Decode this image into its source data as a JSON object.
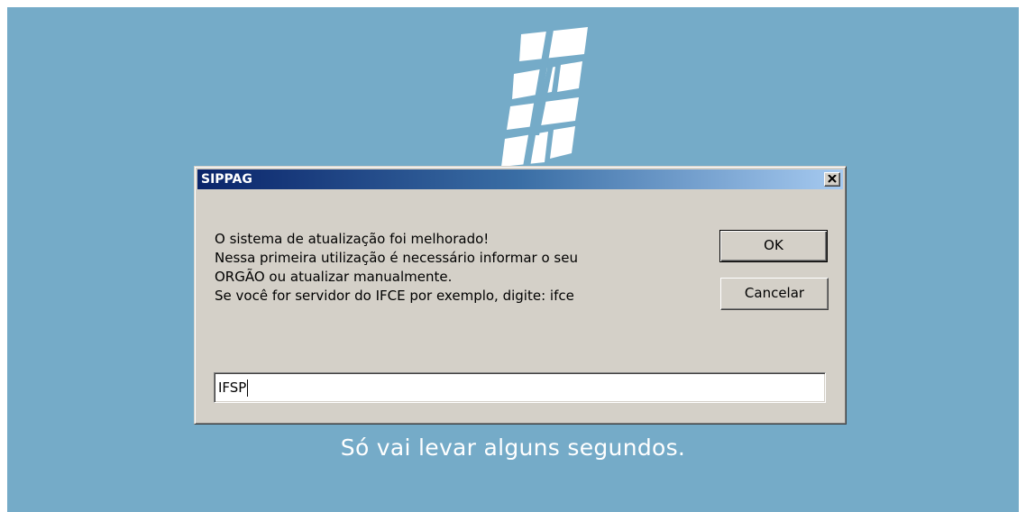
{
  "dialog": {
    "title": "SIPPAG",
    "message_lines": [
      "O sistema de atualização foi melhorado!",
      "Nessa primeira utilização é necessário informar o seu",
      "ORGÃO ou atualizar manualmente.",
      "Se você for servidor do IFCE por exemplo, digite: ifce"
    ],
    "ok_label": "OK",
    "cancel_label": "Cancelar",
    "input_value": "IFSP",
    "close_icon": "close-icon"
  },
  "splash": {
    "status_text": "Só vai levar alguns segundos.",
    "logo_icon": "sippag-logo",
    "background_color": "#75abc8"
  },
  "colors": {
    "titlebar_start": "#0a246a",
    "titlebar_end": "#a6caf0",
    "dialog_face": "#d4d0c8"
  }
}
